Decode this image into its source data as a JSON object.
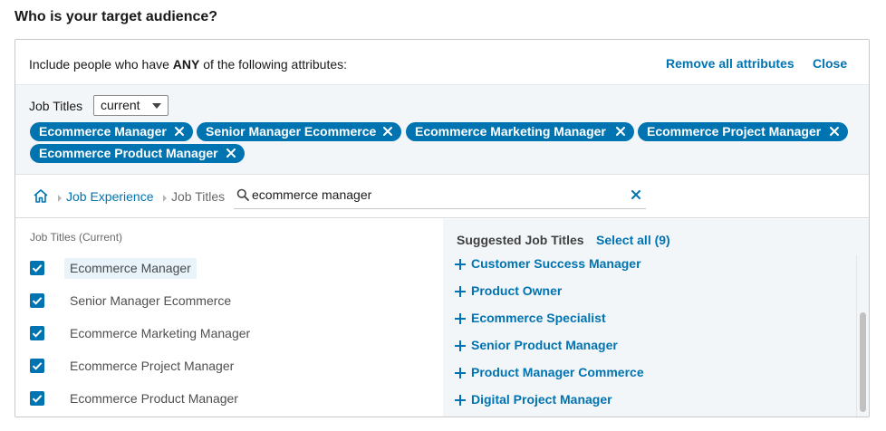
{
  "page": {
    "title": "Who is your target audience?"
  },
  "header": {
    "include_prefix": "Include people who have ",
    "include_bold": "ANY",
    "include_suffix": " of the following attributes:",
    "remove_all_label": "Remove all attributes",
    "close_label": "Close"
  },
  "selection": {
    "label": "Job Titles",
    "dropdown_value": "current",
    "pills": [
      "Ecommerce Manager",
      "Senior Manager Ecommerce",
      "Ecommerce Marketing Manager",
      "Ecommerce Project Manager",
      "Ecommerce Product Manager"
    ]
  },
  "browse": {
    "breadcrumb": [
      "Job Experience",
      "Job Titles"
    ],
    "search_value": "ecommerce manager",
    "icons": {
      "home": "home-icon",
      "search": "search-icon",
      "clear": "clear-icon"
    }
  },
  "results": {
    "heading": "Job Titles (Current)",
    "items": [
      {
        "label": "Ecommerce Manager",
        "checked": true
      },
      {
        "label": "Senior Manager Ecommerce",
        "checked": true
      },
      {
        "label": "Ecommerce Marketing Manager",
        "checked": true
      },
      {
        "label": "Ecommerce Project Manager",
        "checked": true
      },
      {
        "label": "Ecommerce Product Manager",
        "checked": true
      }
    ]
  },
  "suggestions": {
    "heading": "Suggested Job Titles",
    "select_all_label": "Select all (9)",
    "items": [
      "Customer Success Manager",
      "Product Owner",
      "Ecommerce Specialist",
      "Senior Product Manager",
      "Product Manager Commerce",
      "Digital Project Manager"
    ]
  },
  "colors": {
    "accent": "#0073b1",
    "panel_bg": "#f3f6f8",
    "highlight": "#e8f3fa"
  }
}
